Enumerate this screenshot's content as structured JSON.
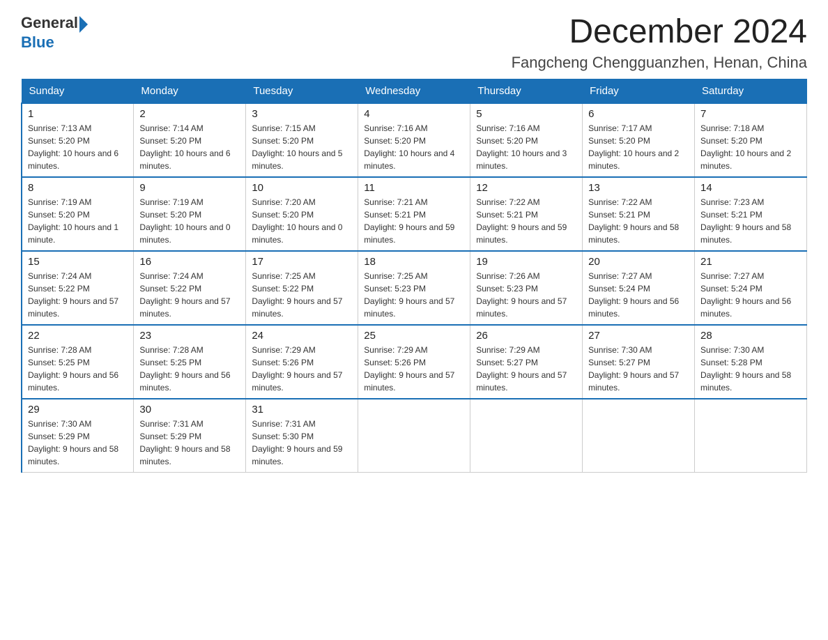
{
  "header": {
    "logo_general": "General",
    "logo_blue": "Blue",
    "month_title": "December 2024",
    "location": "Fangcheng Chengguanzhen, Henan, China"
  },
  "days_of_week": [
    "Sunday",
    "Monday",
    "Tuesday",
    "Wednesday",
    "Thursday",
    "Friday",
    "Saturday"
  ],
  "weeks": [
    [
      {
        "day": "1",
        "sunrise": "7:13 AM",
        "sunset": "5:20 PM",
        "daylight": "10 hours and 6 minutes."
      },
      {
        "day": "2",
        "sunrise": "7:14 AM",
        "sunset": "5:20 PM",
        "daylight": "10 hours and 6 minutes."
      },
      {
        "day": "3",
        "sunrise": "7:15 AM",
        "sunset": "5:20 PM",
        "daylight": "10 hours and 5 minutes."
      },
      {
        "day": "4",
        "sunrise": "7:16 AM",
        "sunset": "5:20 PM",
        "daylight": "10 hours and 4 minutes."
      },
      {
        "day": "5",
        "sunrise": "7:16 AM",
        "sunset": "5:20 PM",
        "daylight": "10 hours and 3 minutes."
      },
      {
        "day": "6",
        "sunrise": "7:17 AM",
        "sunset": "5:20 PM",
        "daylight": "10 hours and 2 minutes."
      },
      {
        "day": "7",
        "sunrise": "7:18 AM",
        "sunset": "5:20 PM",
        "daylight": "10 hours and 2 minutes."
      }
    ],
    [
      {
        "day": "8",
        "sunrise": "7:19 AM",
        "sunset": "5:20 PM",
        "daylight": "10 hours and 1 minute."
      },
      {
        "day": "9",
        "sunrise": "7:19 AM",
        "sunset": "5:20 PM",
        "daylight": "10 hours and 0 minutes."
      },
      {
        "day": "10",
        "sunrise": "7:20 AM",
        "sunset": "5:20 PM",
        "daylight": "10 hours and 0 minutes."
      },
      {
        "day": "11",
        "sunrise": "7:21 AM",
        "sunset": "5:21 PM",
        "daylight": "9 hours and 59 minutes."
      },
      {
        "day": "12",
        "sunrise": "7:22 AM",
        "sunset": "5:21 PM",
        "daylight": "9 hours and 59 minutes."
      },
      {
        "day": "13",
        "sunrise": "7:22 AM",
        "sunset": "5:21 PM",
        "daylight": "9 hours and 58 minutes."
      },
      {
        "day": "14",
        "sunrise": "7:23 AM",
        "sunset": "5:21 PM",
        "daylight": "9 hours and 58 minutes."
      }
    ],
    [
      {
        "day": "15",
        "sunrise": "7:24 AM",
        "sunset": "5:22 PM",
        "daylight": "9 hours and 57 minutes."
      },
      {
        "day": "16",
        "sunrise": "7:24 AM",
        "sunset": "5:22 PM",
        "daylight": "9 hours and 57 minutes."
      },
      {
        "day": "17",
        "sunrise": "7:25 AM",
        "sunset": "5:22 PM",
        "daylight": "9 hours and 57 minutes."
      },
      {
        "day": "18",
        "sunrise": "7:25 AM",
        "sunset": "5:23 PM",
        "daylight": "9 hours and 57 minutes."
      },
      {
        "day": "19",
        "sunrise": "7:26 AM",
        "sunset": "5:23 PM",
        "daylight": "9 hours and 57 minutes."
      },
      {
        "day": "20",
        "sunrise": "7:27 AM",
        "sunset": "5:24 PM",
        "daylight": "9 hours and 56 minutes."
      },
      {
        "day": "21",
        "sunrise": "7:27 AM",
        "sunset": "5:24 PM",
        "daylight": "9 hours and 56 minutes."
      }
    ],
    [
      {
        "day": "22",
        "sunrise": "7:28 AM",
        "sunset": "5:25 PM",
        "daylight": "9 hours and 56 minutes."
      },
      {
        "day": "23",
        "sunrise": "7:28 AM",
        "sunset": "5:25 PM",
        "daylight": "9 hours and 56 minutes."
      },
      {
        "day": "24",
        "sunrise": "7:29 AM",
        "sunset": "5:26 PM",
        "daylight": "9 hours and 57 minutes."
      },
      {
        "day": "25",
        "sunrise": "7:29 AM",
        "sunset": "5:26 PM",
        "daylight": "9 hours and 57 minutes."
      },
      {
        "day": "26",
        "sunrise": "7:29 AM",
        "sunset": "5:27 PM",
        "daylight": "9 hours and 57 minutes."
      },
      {
        "day": "27",
        "sunrise": "7:30 AM",
        "sunset": "5:27 PM",
        "daylight": "9 hours and 57 minutes."
      },
      {
        "day": "28",
        "sunrise": "7:30 AM",
        "sunset": "5:28 PM",
        "daylight": "9 hours and 58 minutes."
      }
    ],
    [
      {
        "day": "29",
        "sunrise": "7:30 AM",
        "sunset": "5:29 PM",
        "daylight": "9 hours and 58 minutes."
      },
      {
        "day": "30",
        "sunrise": "7:31 AM",
        "sunset": "5:29 PM",
        "daylight": "9 hours and 58 minutes."
      },
      {
        "day": "31",
        "sunrise": "7:31 AM",
        "sunset": "5:30 PM",
        "daylight": "9 hours and 59 minutes."
      },
      null,
      null,
      null,
      null
    ]
  ]
}
